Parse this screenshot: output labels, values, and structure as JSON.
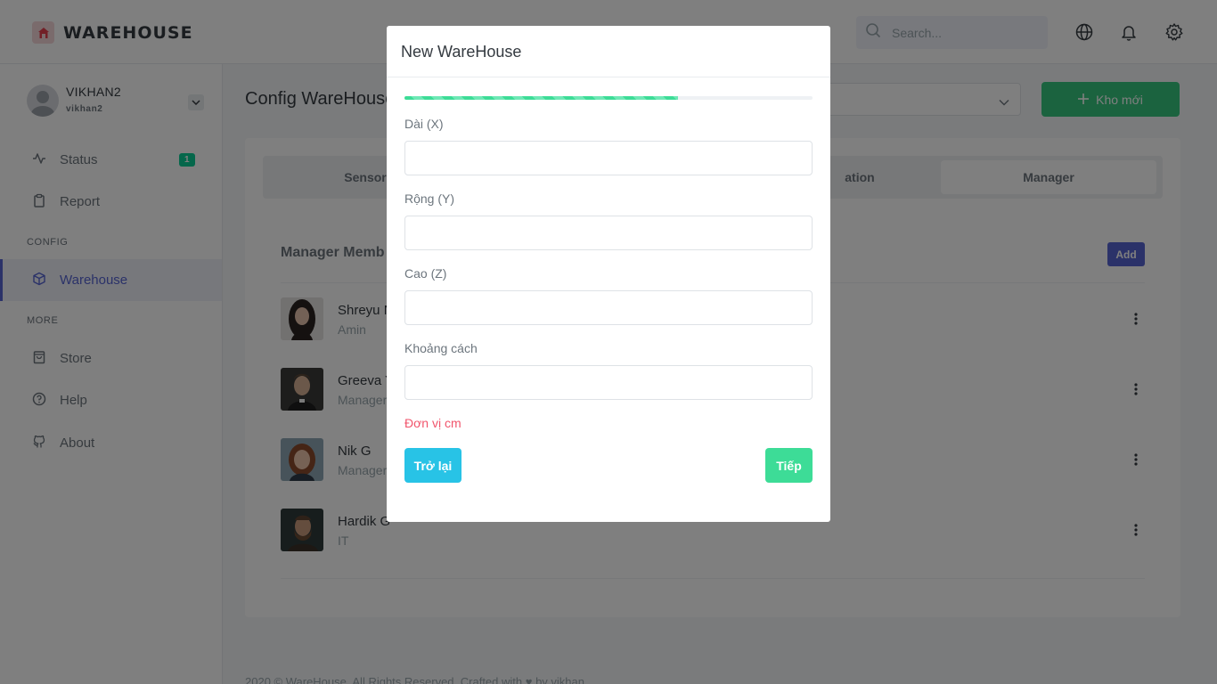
{
  "app": {
    "logo_text": "WAREHOUSE"
  },
  "topbar": {
    "search_placeholder": "Search...",
    "icons": [
      "search-icon",
      "globe-icon",
      "bell-icon",
      "gear-icon"
    ]
  },
  "sidebar": {
    "user": {
      "name": "VIKHAN2",
      "username": "vikhan2"
    },
    "items": [
      {
        "label": "Status",
        "icon": "activity-icon",
        "badge": "1"
      },
      {
        "label": "Report",
        "icon": "clipboard-icon"
      }
    ],
    "config_title": "CONFIG",
    "config_items": [
      {
        "label": "Warehouse",
        "icon": "box-icon",
        "active": true
      }
    ],
    "more_title": "MORE",
    "more_items": [
      {
        "label": "Store",
        "icon": "shopping-bag-icon"
      },
      {
        "label": "Help",
        "icon": "help-circle-icon"
      },
      {
        "label": "About",
        "icon": "github-icon"
      }
    ]
  },
  "main": {
    "page_title": "Config WareHouse",
    "new_button": "Kho mới",
    "tabs": [
      {
        "label": "Sensor"
      },
      {
        "label": "ation"
      },
      {
        "label": "Manager",
        "active": true
      }
    ],
    "section_title": "Manager Memb",
    "add_button": "Add",
    "members": [
      {
        "name": "Shreyu N",
        "role": "Amin"
      },
      {
        "name": "Greeva Y",
        "role": "Manager"
      },
      {
        "name": "Nik G",
        "role": "Manager"
      },
      {
        "name": "Hardik G",
        "role": "IT"
      }
    ],
    "footer": "2020 © WareHouse. All Rights Reserved. Crafted with ♥ by vikhan"
  },
  "modal": {
    "title": "New WareHouse",
    "progress_percent": 67,
    "fields": [
      {
        "label": "Dài (X)",
        "value": ""
      },
      {
        "label": "Rộng (Y)",
        "value": ""
      },
      {
        "label": "Cao (Z)",
        "value": ""
      },
      {
        "label": "Khoảng cách",
        "value": ""
      }
    ],
    "unit_note": "Đơn vị cm",
    "back_button": "Trở lại",
    "next_button": "Tiếp"
  },
  "colors": {
    "primary": "#5664d2",
    "success": "#36c77f",
    "info": "#28c3e6",
    "danger": "#f1556c",
    "progress": "#3ddc97"
  }
}
